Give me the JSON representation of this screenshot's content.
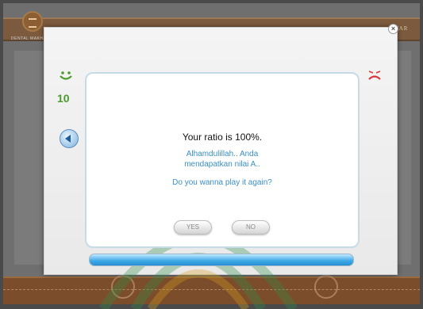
{
  "app": {
    "logo_caption": "DENTAL MAKHAAJ",
    "corner_label": "TAR"
  },
  "dialog": {
    "score": "10",
    "ratio_text": "Your ratio is 100%.",
    "result_message": "Alhamdulillah.. Anda mendapatkan nilai A..",
    "play_again_prompt": "Do you wanna play it again?",
    "yes_label": "YES",
    "no_label": "NO",
    "close_symbol": "×",
    "progress_fraction": 1.0,
    "colors": {
      "accent_text": "#3a8fc6",
      "score_green": "#4a9a2c",
      "sad_red": "#d9383a",
      "progress_blue": "#3ca7e6"
    },
    "icons": [
      "smile-icon",
      "sad-icon",
      "back-arrow-icon",
      "close-icon"
    ]
  }
}
